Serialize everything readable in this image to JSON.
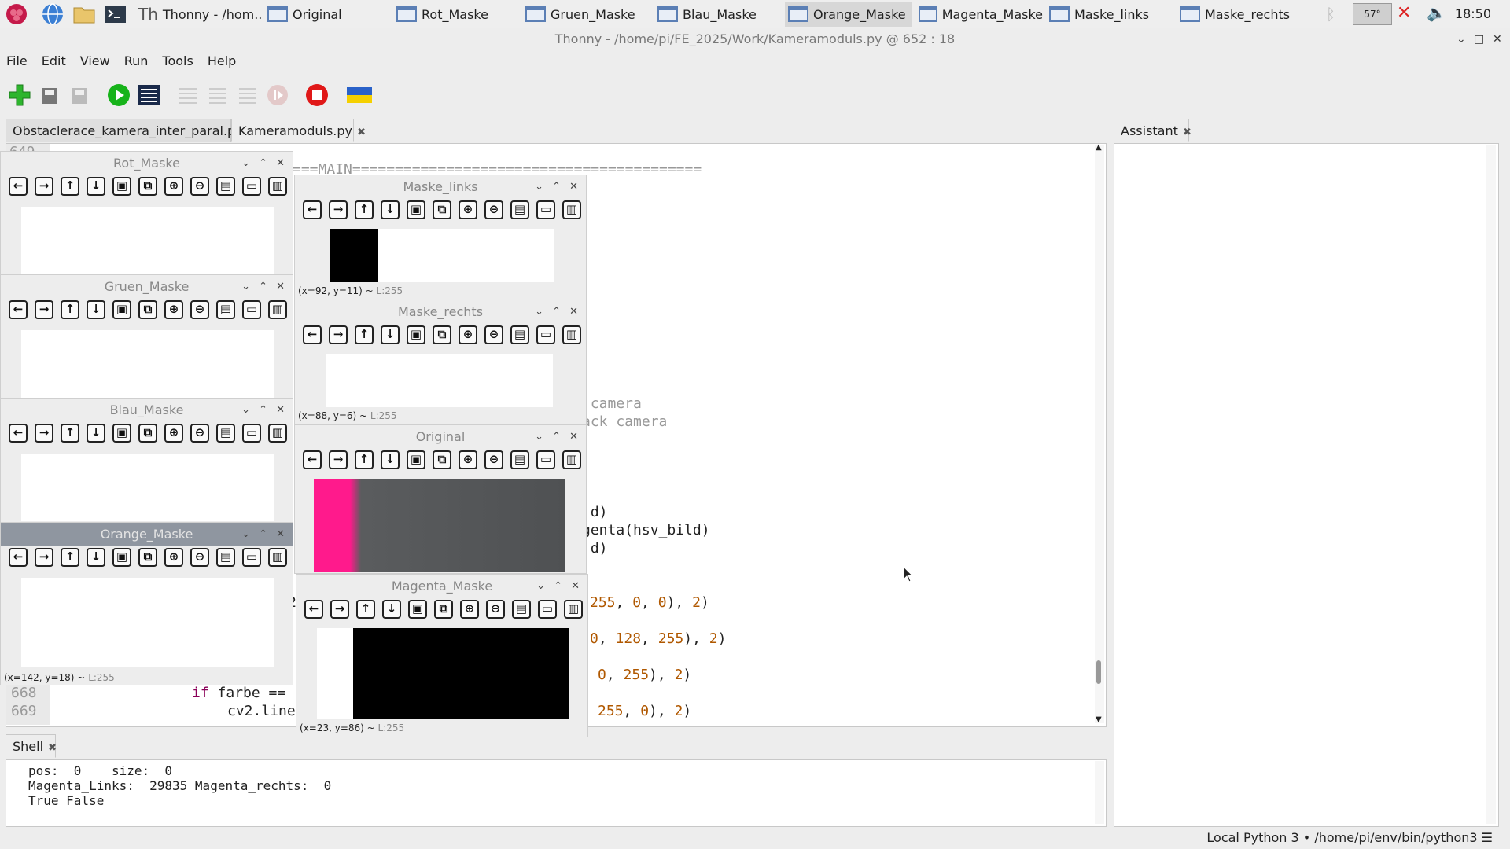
{
  "taskbar": {
    "sys_temp": "57°",
    "clock": "18:50",
    "buttons": [
      {
        "label": "Thonny  -  /hom...",
        "active": false
      },
      {
        "label": "Original",
        "active": false
      },
      {
        "label": "Rot_Maske",
        "active": false
      },
      {
        "label": "Gruen_Maske",
        "active": false
      },
      {
        "label": "Blau_Maske",
        "active": false
      },
      {
        "label": "Orange_Maske",
        "active": true
      },
      {
        "label": "Magenta_Maske",
        "active": false
      },
      {
        "label": "Maske_links",
        "active": false
      },
      {
        "label": "Maske_rechts",
        "active": false
      }
    ]
  },
  "window": {
    "title": "Thonny  -  /home/pi/FE_2025/Work/Kameramoduls.py  @  652 : 18"
  },
  "menu": [
    "File",
    "Edit",
    "View",
    "Run",
    "Tools",
    "Help"
  ],
  "editor": {
    "tabs": [
      {
        "label": "Obstaclerace_kamera_inter_paral.py",
        "selected": false
      },
      {
        "label": "Kameramoduls.py",
        "selected": true
      }
    ],
    "partial_line_number": "649",
    "lines": [
      {
        "text": "===MAIN=========================================",
        "cls": "cmt"
      },
      {
        "text": " camera",
        "cls": "cmt"
      },
      {
        "text": "ack camera",
        "cls": "cmt"
      },
      {
        "text": ".d)",
        "cls": ""
      },
      {
        "text": "genta(hsv_bild)",
        "cls": ""
      },
      {
        "text": ".d)",
        "cls": ""
      }
    ],
    "color_lines": [
      {
        "a": "255",
        "b": "0",
        "c": "0"
      },
      {
        "a": "0",
        "b": "128",
        "c": "255"
      },
      {
        "a": "0",
        "b": "255",
        "c": ""
      },
      {
        "a": "255",
        "b": "0",
        "c": ""
      }
    ],
    "line_668": {
      "num": "668",
      "kw": "if",
      "rest": " farbe == "
    },
    "line_669": {
      "num": "669",
      "rest": "cv2.line"
    }
  },
  "assistant": {
    "tab": "Assistant"
  },
  "shell": {
    "tab": "Shell",
    "lines": [
      "pos:  0    size:  0",
      "Magenta_Links:  29835 Magenta_rechts:  0",
      "True False"
    ]
  },
  "status": "Local Python 3  •  /home/pi/env/bin/python3",
  "cv_windows": [
    {
      "id": "rot",
      "title": "Rot_Maske",
      "status": "",
      "lum": ""
    },
    {
      "id": "gruen",
      "title": "Gruen_Maske",
      "status": "",
      "lum": ""
    },
    {
      "id": "blau",
      "title": "Blau_Maske",
      "status": "",
      "lum": ""
    },
    {
      "id": "orange",
      "title": "Orange_Maske",
      "status": "(x=142, y=18) ~",
      "lum": "L:255"
    },
    {
      "id": "links",
      "title": "Maske_links",
      "status": "(x=92, y=11) ~",
      "lum": "L:255"
    },
    {
      "id": "rechts",
      "title": "Maske_rechts",
      "status": "(x=88, y=6) ~",
      "lum": "L:255"
    },
    {
      "id": "original",
      "title": "Original",
      "status": "",
      "lum": ""
    },
    {
      "id": "magenta",
      "title": "Magenta_Maske",
      "status": "(x=23, y=86) ~",
      "lum": "L:255"
    }
  ],
  "cv_tool_icons": [
    "arrow-left-icon",
    "arrow-right-icon",
    "arrow-up-icon",
    "arrow-down-icon",
    "fit-image-icon",
    "zoom-image-icon",
    "zoom-in-icon",
    "zoom-out-icon",
    "save-icon",
    "copy-icon",
    "properties-icon"
  ],
  "colors": {
    "accent_focus_title": "#8f96a0",
    "orange_code": "#b05800",
    "magenta_pink": "#ff1a8c"
  }
}
